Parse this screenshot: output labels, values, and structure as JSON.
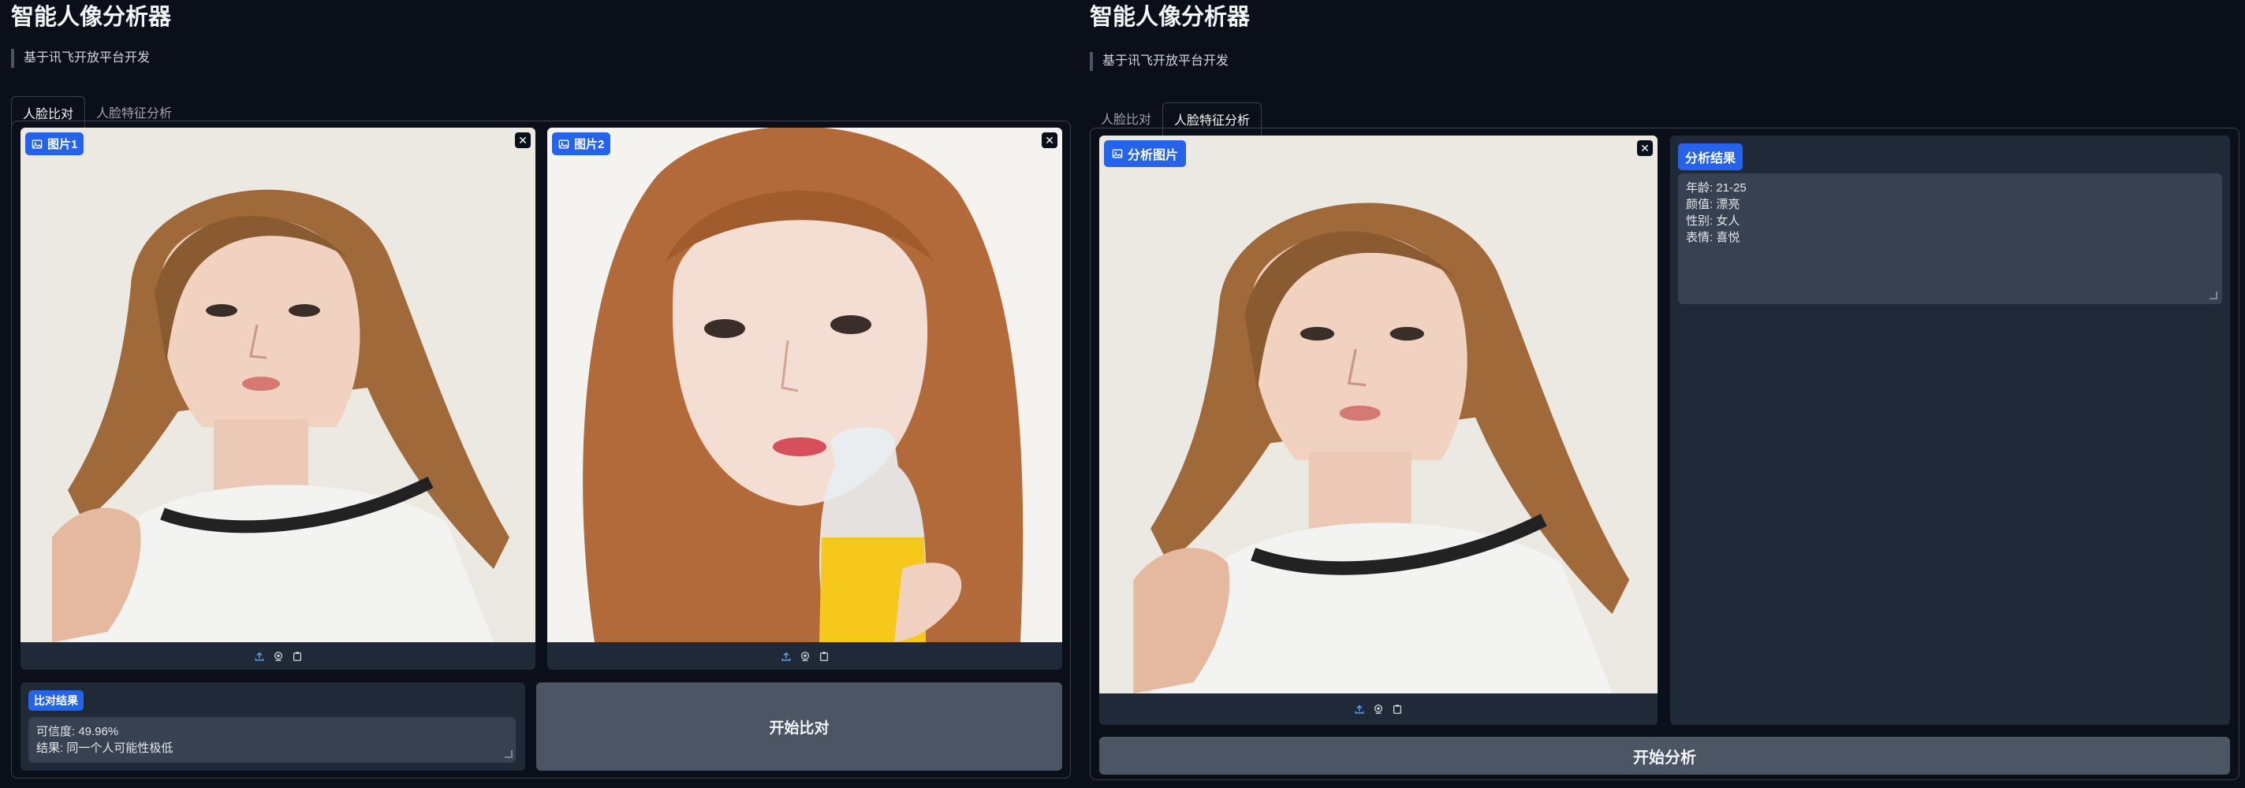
{
  "app": {
    "title": "智能人像分析器",
    "subtitle": "基于讯飞开放平台开发"
  },
  "tabs": [
    "人脸比对",
    "人脸特征分析"
  ],
  "compare": {
    "image1_label": "图片1",
    "image2_label": "图片2",
    "result_label": "比对结果",
    "result_text": "可信度: 49.96%\n结果: 同一个人可能性极低",
    "button": "开始比对"
  },
  "analysis": {
    "image_label": "分析图片",
    "result_label": "分析结果",
    "result_text": "年龄: 21-25\n颜值: 漂亮\n性别: 女人\n表情: 喜悦",
    "button": "开始分析"
  },
  "icons": {
    "upload": "upload-icon",
    "webcam": "webcam-icon",
    "clipboard": "clipboard-icon",
    "close": "close-icon",
    "image": "image-icon"
  },
  "colors": {
    "background": "#0b0f19",
    "accent": "#2563eb",
    "panel": "#1f2937",
    "button": "#4b5563"
  }
}
